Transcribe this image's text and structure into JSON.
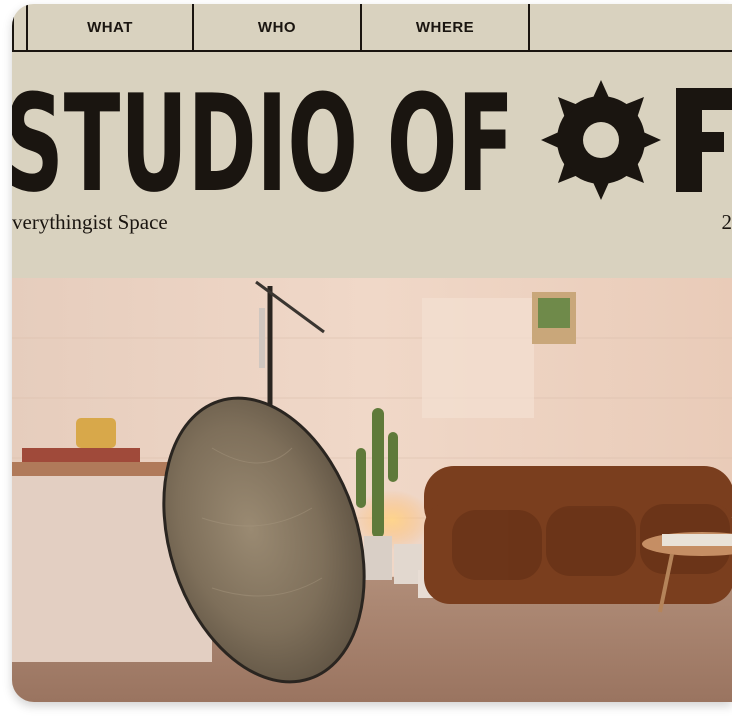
{
  "nav": {
    "items": [
      {
        "label": "WHAT"
      },
      {
        "label": "WHO"
      },
      {
        "label": "WHERE"
      }
    ]
  },
  "hero": {
    "title": "STUDIO OF",
    "tagline": "verythingist Space",
    "trailing_number": "2"
  },
  "photo": {
    "icon": "studio-photo"
  },
  "colors": {
    "background": "#d9d2bf",
    "ink": "#1a1510"
  }
}
